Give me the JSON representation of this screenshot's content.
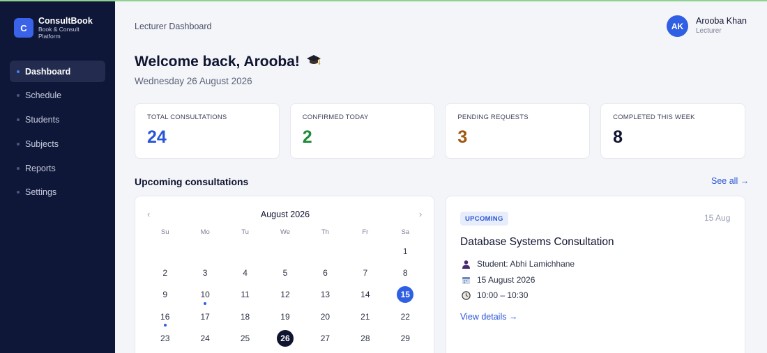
{
  "brand": {
    "logo_letter": "C",
    "name": "ConsultBook",
    "tagline": "Book & Consult Platform",
    "color": "#3a63ea"
  },
  "sidebar": {
    "items": [
      {
        "label": "Dashboard",
        "active": true
      },
      {
        "label": "Schedule",
        "active": false
      },
      {
        "label": "Students",
        "active": false
      },
      {
        "label": "Subjects",
        "active": false
      },
      {
        "label": "Reports",
        "active": false
      },
      {
        "label": "Settings",
        "active": false
      }
    ]
  },
  "header": {
    "breadcrumb": "Lecturer Dashboard",
    "user": {
      "initials": "AK",
      "name": "Arooba Khan",
      "role": "Lecturer"
    }
  },
  "welcome": {
    "title": "Welcome back, Arooba!",
    "date": "Wednesday 26 August 2026",
    "icon": "graduation-cap-icon"
  },
  "stats": [
    {
      "label": "TOTAL CONSULTATIONS",
      "value": "24",
      "color": "#2a56d6"
    },
    {
      "label": "CONFIRMED TODAY",
      "value": "2",
      "color": "#1f8a3b"
    },
    {
      "label": "PENDING REQUESTS",
      "value": "3",
      "color": "#a0560f"
    },
    {
      "label": "COMPLETED THIS WEEK",
      "value": "8",
      "color": "#0f1430"
    }
  ],
  "upcoming": {
    "title": "Upcoming consultations",
    "see_all": "See all →"
  },
  "calendar": {
    "month": "August 2026",
    "prev": "‹",
    "next": "›",
    "weekdays": [
      "Su",
      "Mo",
      "Tu",
      "We",
      "Th",
      "Fr",
      "Sa"
    ],
    "leading_blanks": 6,
    "days": [
      "1",
      "2",
      "3",
      "4",
      "5",
      "6",
      "7",
      "8",
      "9",
      "10",
      "11",
      "12",
      "13",
      "14",
      "15",
      "16",
      "17",
      "18",
      "19",
      "20",
      "21",
      "22",
      "23",
      "24",
      "25",
      "26",
      "27",
      "28",
      "29"
    ],
    "selected": "15",
    "today": "26",
    "marked": [
      "10",
      "16"
    ]
  },
  "consultation": {
    "status": "UPCOMING",
    "short_date": "15 Aug",
    "title": "Database Systems Consultation",
    "student": "Student: Abhi Lamichhane",
    "date": "15 August 2026",
    "time": "10:00 – 10:30",
    "link": "View details →"
  }
}
